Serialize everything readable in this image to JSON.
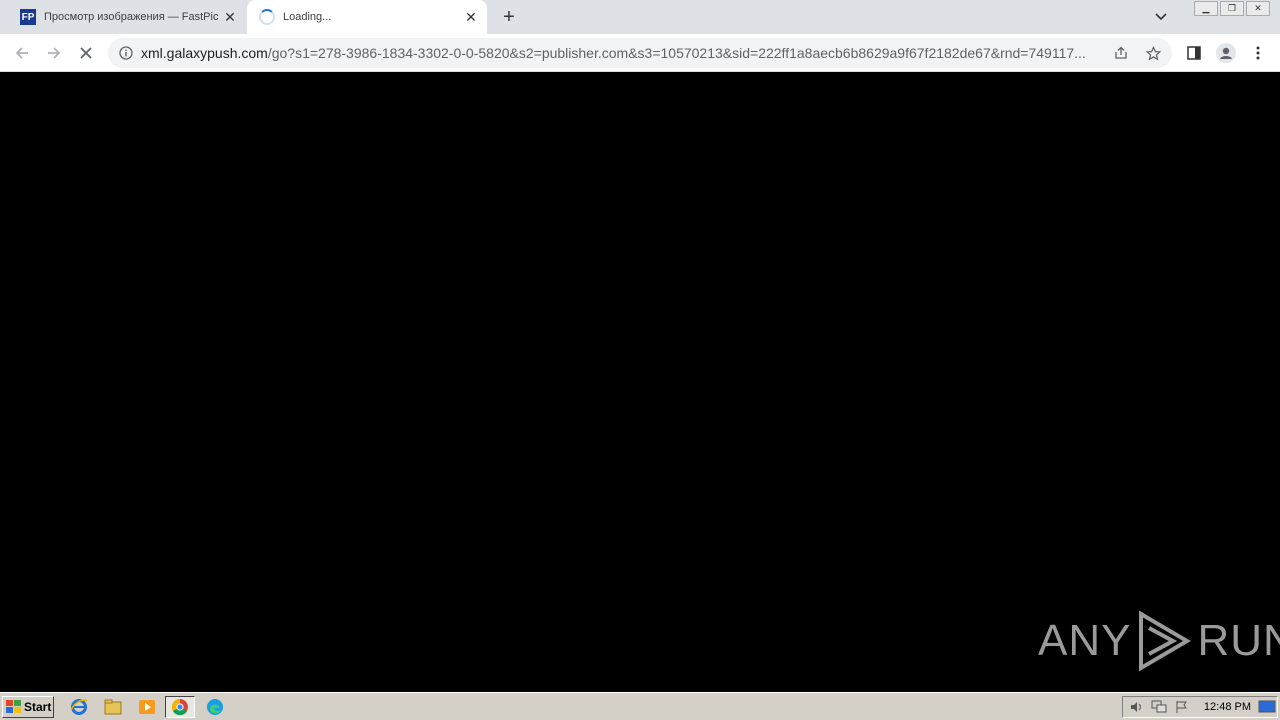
{
  "browser": {
    "tabs": [
      {
        "title": "Просмотр изображения — FastPic",
        "favicon": "fastpic-icon",
        "active": false
      },
      {
        "title": "Loading...",
        "favicon": "loading-spinner-icon",
        "active": true
      }
    ],
    "favicon_text": "FP",
    "address": {
      "host": "xml.galaxypush.com",
      "path": "/go?s1=278-3986-1834-3302-0-0-5820&s2=publisher.com&s3=10570213&sid=222ff1a8aecb6b8629a9f67f2182de67&rnd=749117..."
    }
  },
  "watermark": {
    "left": "ANY",
    "right": "RUN"
  },
  "taskbar": {
    "start_label": "Start",
    "clock": "12:48 PM",
    "pinned": [
      "ie-icon",
      "explorer-icon",
      "media-player-icon",
      "chrome-icon",
      "edge-icon"
    ]
  },
  "colors": {
    "tabstrip": "#dee1e6",
    "content": "#000000",
    "taskbar": "#d4d0c8"
  }
}
